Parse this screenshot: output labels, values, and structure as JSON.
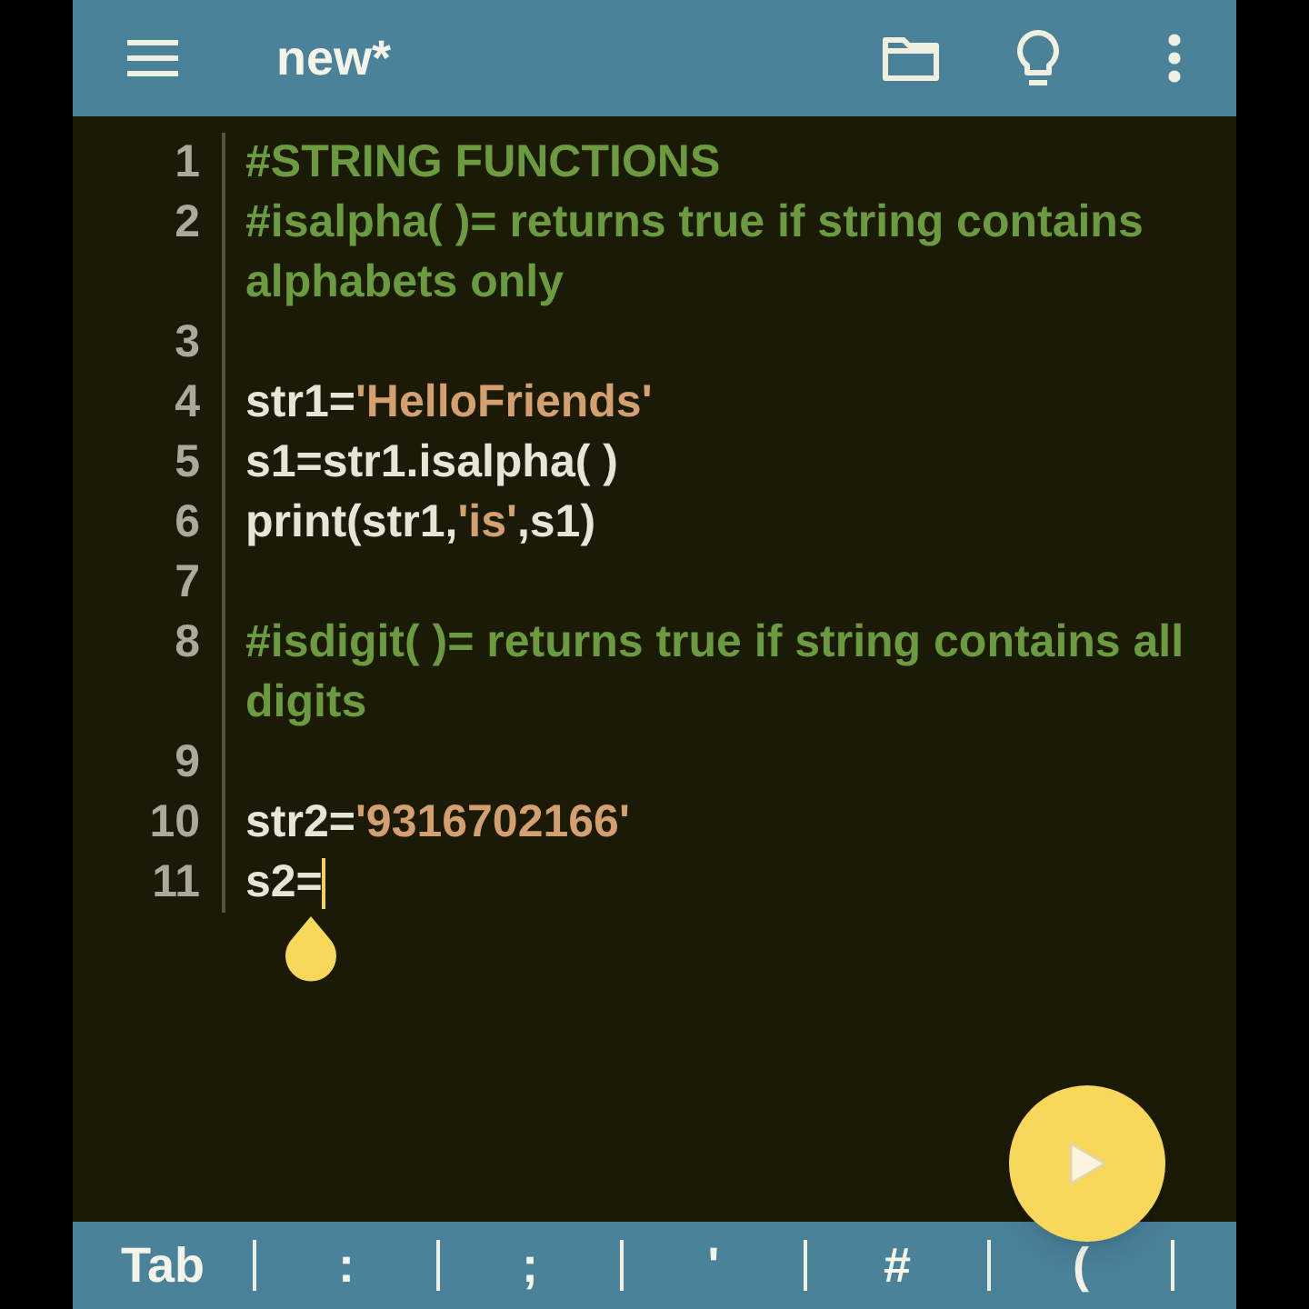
{
  "toolbar": {
    "title": "new*"
  },
  "lines": [
    {
      "number": "1",
      "tokens": [
        {
          "kind": "comment",
          "text": "#STRING FUNCTIONS"
        }
      ]
    },
    {
      "number": "2",
      "tokens": [
        {
          "kind": "comment",
          "text": "#isalpha( )= returns true if string contains alphabets only"
        }
      ]
    },
    {
      "number": "3"
    },
    {
      "number": "4",
      "tokens": [
        {
          "kind": "code",
          "text": "str1="
        },
        {
          "kind": "string",
          "text": "'HelloFriends'"
        }
      ]
    },
    {
      "number": "5",
      "tokens": [
        {
          "kind": "code",
          "text": "s1=str1.isalpha( )"
        }
      ]
    },
    {
      "number": "6",
      "tokens": [
        {
          "kind": "code",
          "text": "print(str1,"
        },
        {
          "kind": "string",
          "text": "'is'"
        },
        {
          "kind": "code",
          "text": ",s1)"
        }
      ]
    },
    {
      "number": "7"
    },
    {
      "number": "8",
      "tokens": [
        {
          "kind": "comment",
          "text": "#isdigit( )= returns true if string contains all digits"
        }
      ]
    },
    {
      "number": "9"
    },
    {
      "number": "10",
      "tokens": [
        {
          "kind": "code",
          "text": "str2="
        },
        {
          "kind": "string",
          "text": "'9316702166'"
        }
      ]
    },
    {
      "number": "11",
      "tokens": [
        {
          "kind": "code",
          "text": "s2="
        }
      ],
      "cursor": true
    }
  ],
  "keys": [
    "Tab",
    ":",
    ";",
    "'",
    "#",
    "("
  ]
}
